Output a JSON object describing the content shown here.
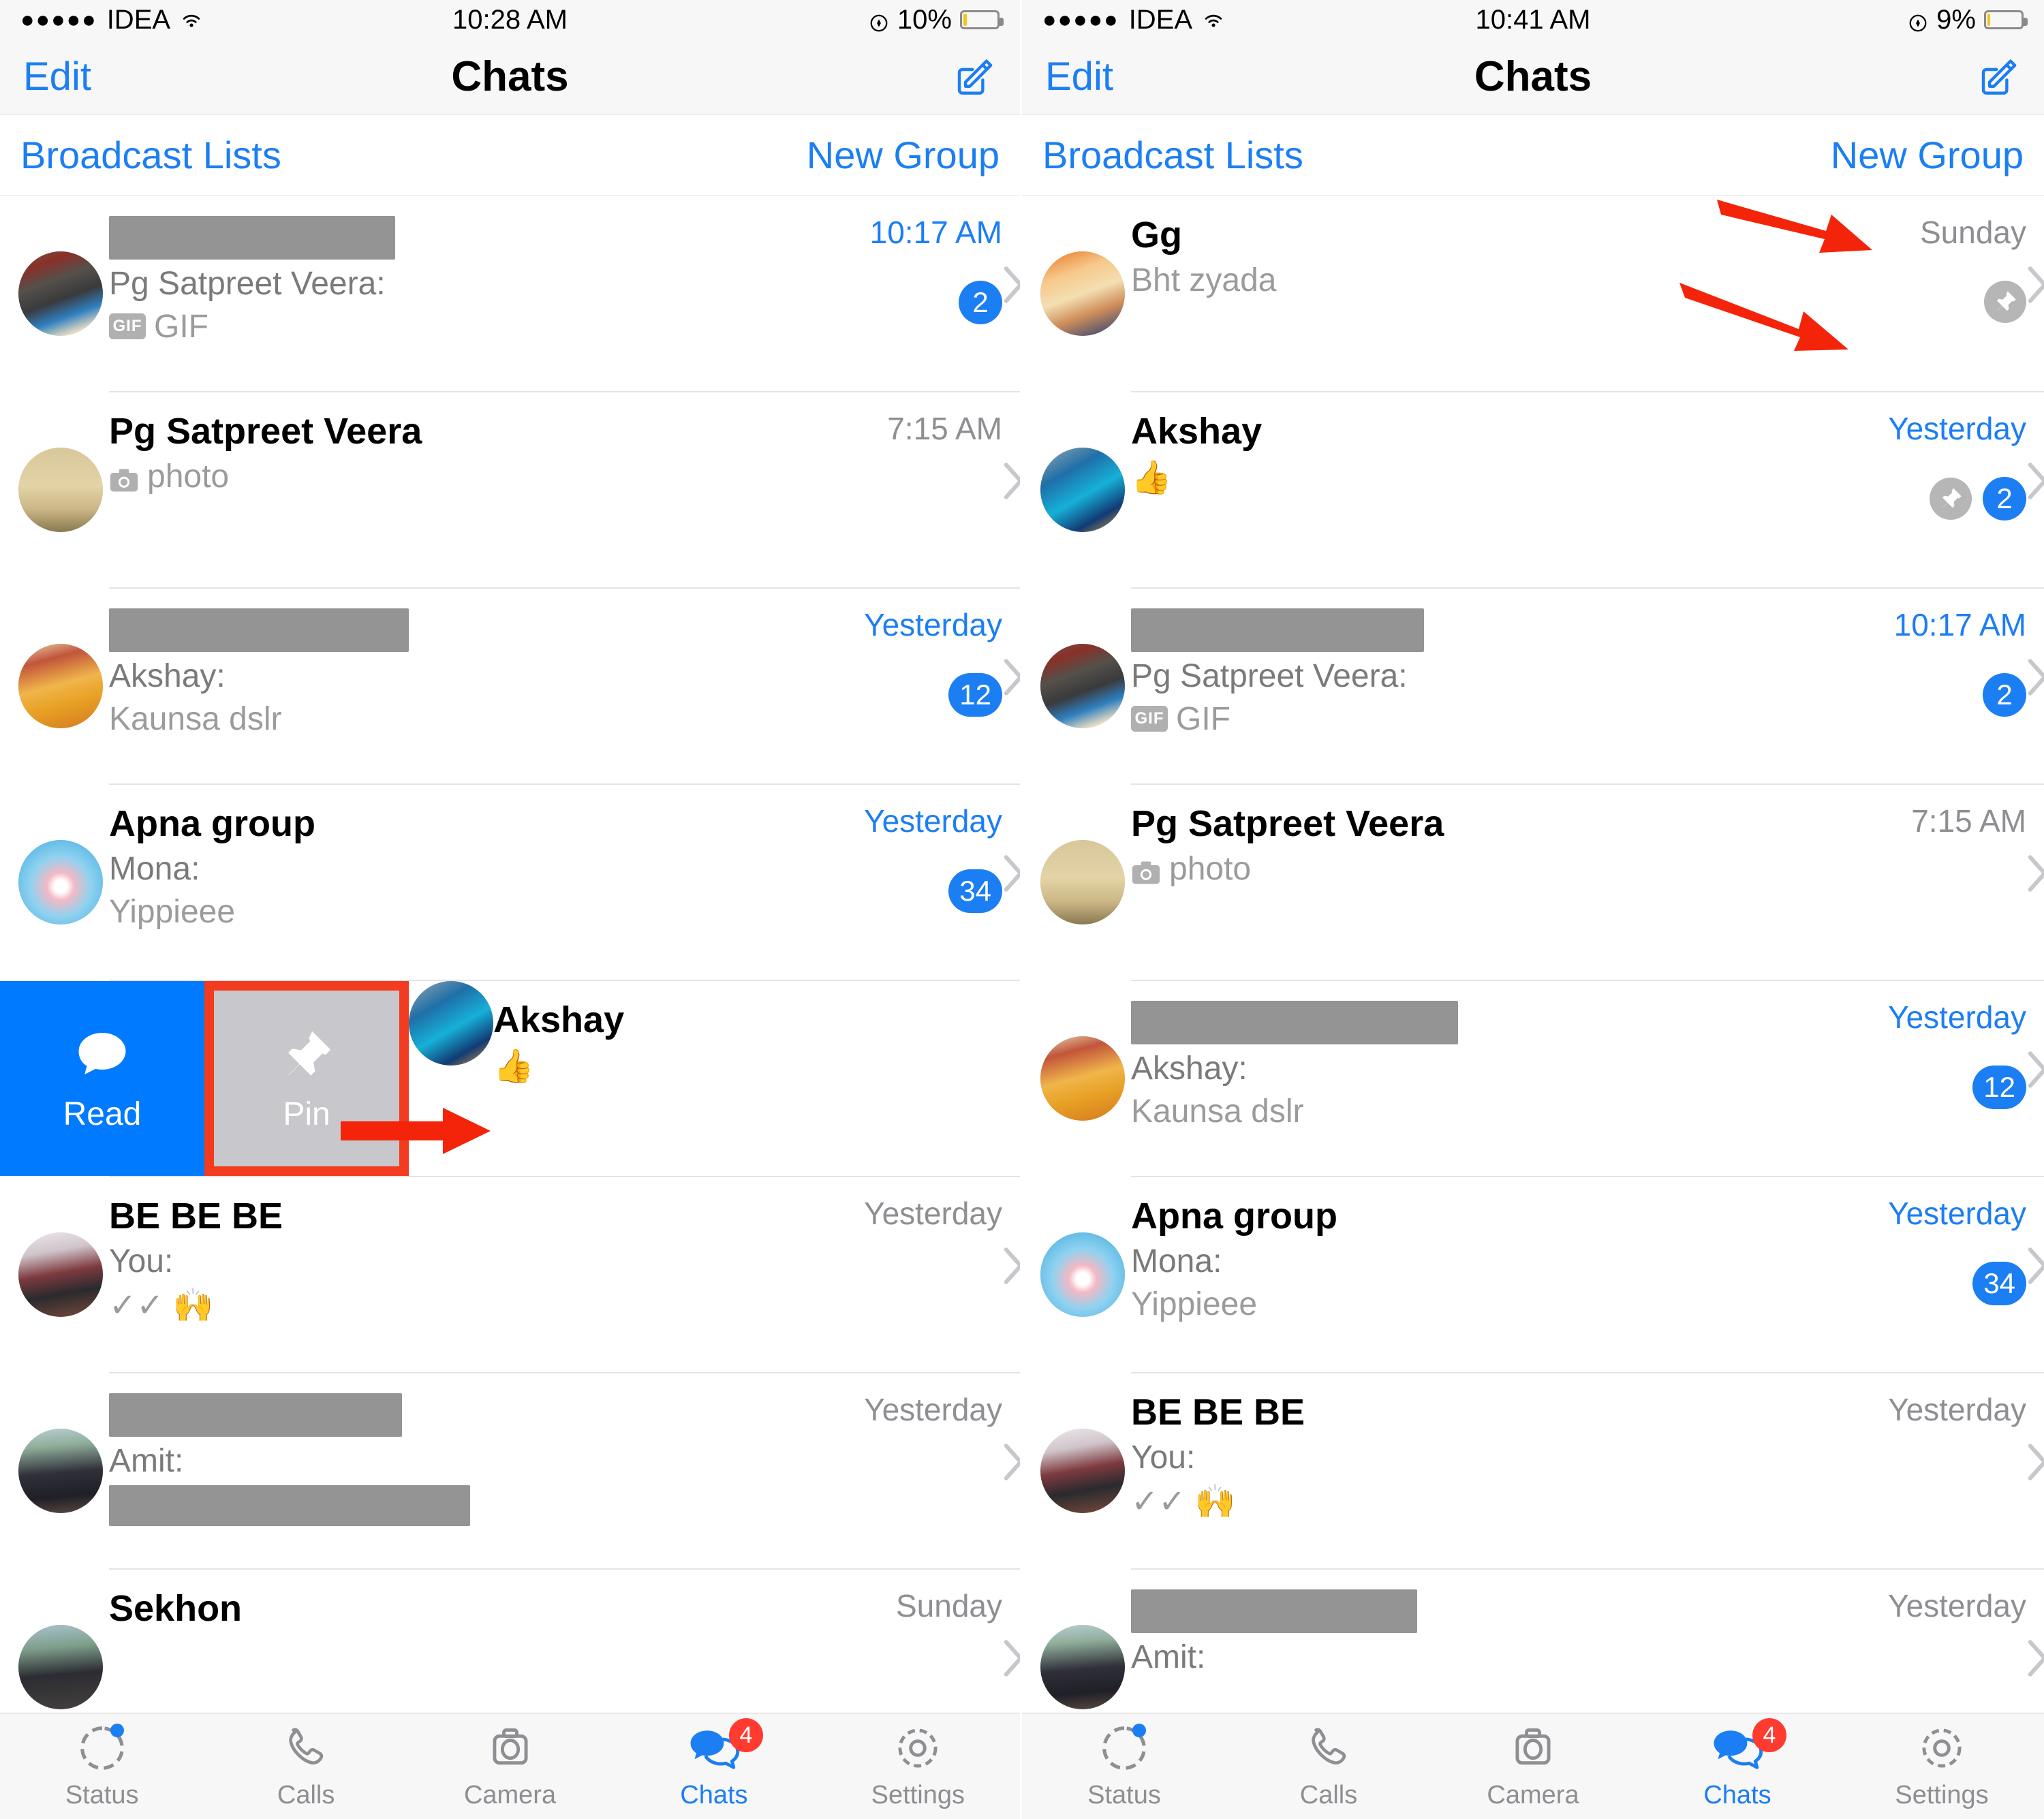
{
  "panels": [
    {
      "status": {
        "signal_dots": "●●●●●",
        "carrier": "IDEA",
        "time": "10:28 AM",
        "battery_pct": "10%",
        "battery_level": 10
      },
      "nav": {
        "edit": "Edit",
        "title": "Chats"
      },
      "header": {
        "broadcast": "Broadcast Lists",
        "new_group": "New Group"
      },
      "rows": [
        {
          "kind": "chat",
          "title": "",
          "title_redacted": true,
          "title_redact_w": 420,
          "sender": "Pg Satpreet Veera:",
          "preview": "GIF",
          "preview_icon": "gif-chip",
          "time": "10:17 AM",
          "time_blue": true,
          "badge": "2",
          "pinned": false,
          "avatar": "market-stall"
        },
        {
          "kind": "chat",
          "title": "Pg Satpreet Veera",
          "sender": "",
          "preview": "photo",
          "preview_icon": "camera-chip",
          "time": "7:15 AM",
          "time_blue": false,
          "badge": "",
          "pinned": false,
          "avatar": "boat-quote"
        },
        {
          "kind": "chat",
          "title": "",
          "title_redacted": true,
          "title_redact_w": 440,
          "sender": "Akshay:",
          "preview": "Kaunsa dslr",
          "preview_icon": "",
          "time": "Yesterday",
          "time_blue": true,
          "badge": "12",
          "pinned": false,
          "avatar": "festival"
        },
        {
          "kind": "chat",
          "title": "Apna group",
          "sender": "Mona:",
          "preview": "Yippieee",
          "preview_icon": "",
          "time": "Yesterday",
          "time_blue": true,
          "badge": "34",
          "pinned": false,
          "avatar": "heart"
        },
        {
          "kind": "swipe",
          "read_label": "Read",
          "pin_label": "Pin",
          "title": "Akshay",
          "preview": "👍",
          "avatar": "shiva"
        },
        {
          "kind": "chat",
          "title": "BE BE BE",
          "sender": "You:",
          "preview": "✓✓ 🙌",
          "preview_icon": "",
          "time": "Yesterday",
          "time_blue": false,
          "badge": "",
          "pinned": false,
          "avatar": "group-selfie"
        },
        {
          "kind": "chat",
          "title": "",
          "title_redacted": true,
          "title_redact_w": 430,
          "sender": "Amit:",
          "preview": "",
          "preview_redacted": true,
          "preview_redact_w": 530,
          "time": "Yesterday",
          "time_blue": false,
          "badge": "",
          "pinned": false,
          "avatar": "friends"
        },
        {
          "kind": "chat",
          "title": "Sekhon",
          "sender": "",
          "preview": "",
          "preview_icon": "",
          "time": "Sunday",
          "time_blue": false,
          "badge": "",
          "pinned": false,
          "avatar": "outdoor"
        }
      ],
      "tabs": [
        {
          "label": "Status",
          "icon": "status-icon",
          "active": false,
          "badge": "",
          "dot": true
        },
        {
          "label": "Calls",
          "icon": "phone-icon",
          "active": false,
          "badge": "",
          "dot": false
        },
        {
          "label": "Camera",
          "icon": "camera-icon",
          "active": false,
          "badge": "",
          "dot": false
        },
        {
          "label": "Chats",
          "icon": "chats-icon",
          "active": true,
          "badge": "4",
          "dot": false
        },
        {
          "label": "Settings",
          "icon": "gear-icon",
          "active": false,
          "badge": "",
          "dot": false
        }
      ]
    },
    {
      "status": {
        "signal_dots": "●●●●●",
        "carrier": "IDEA",
        "time": "10:41 AM",
        "battery_pct": "9%",
        "battery_level": 9
      },
      "nav": {
        "edit": "Edit",
        "title": "Chats"
      },
      "header": {
        "broadcast": "Broadcast Lists",
        "new_group": "New Group"
      },
      "rows": [
        {
          "kind": "chat",
          "title": "Gg",
          "sender": "",
          "preview": "Bht zyada",
          "preview_icon": "",
          "time": "Sunday",
          "time_blue": false,
          "badge": "",
          "pinned": true,
          "avatar": "couple",
          "arrow": true
        },
        {
          "kind": "chat",
          "title": "Akshay",
          "sender": "",
          "preview": "👍",
          "preview_icon": "",
          "time": "Yesterday",
          "time_blue": true,
          "badge": "2",
          "pinned": true,
          "avatar": "shiva",
          "arrow": true
        },
        {
          "kind": "chat",
          "title": "",
          "title_redacted": true,
          "title_redact_w": 430,
          "sender": "Pg Satpreet Veera:",
          "preview": "GIF",
          "preview_icon": "gif-chip",
          "time": "10:17 AM",
          "time_blue": true,
          "badge": "2",
          "pinned": false,
          "avatar": "market-stall"
        },
        {
          "kind": "chat",
          "title": "Pg Satpreet Veera",
          "sender": "",
          "preview": "photo",
          "preview_icon": "camera-chip",
          "time": "7:15 AM",
          "time_blue": false,
          "badge": "",
          "pinned": false,
          "avatar": "boat-quote"
        },
        {
          "kind": "chat",
          "title": "",
          "title_redacted": true,
          "title_redact_w": 480,
          "sender": "Akshay:",
          "preview": "Kaunsa dslr",
          "preview_icon": "",
          "time": "Yesterday",
          "time_blue": true,
          "badge": "12",
          "pinned": false,
          "avatar": "festival"
        },
        {
          "kind": "chat",
          "title": "Apna group",
          "sender": "Mona:",
          "preview": "Yippieee",
          "preview_icon": "",
          "time": "Yesterday",
          "time_blue": true,
          "badge": "34",
          "pinned": false,
          "avatar": "heart"
        },
        {
          "kind": "chat",
          "title": "BE BE BE",
          "sender": "You:",
          "preview": "✓✓ 🙌",
          "preview_icon": "",
          "time": "Yesterday",
          "time_blue": false,
          "badge": "",
          "pinned": false,
          "avatar": "group-selfie"
        },
        {
          "kind": "chat",
          "title": "",
          "title_redacted": true,
          "title_redact_w": 420,
          "sender": "Amit:",
          "preview": "",
          "preview_icon": "",
          "time": "Yesterday",
          "time_blue": false,
          "badge": "",
          "pinned": false,
          "avatar": "friends"
        }
      ],
      "tabs": [
        {
          "label": "Status",
          "icon": "status-icon",
          "active": false,
          "badge": "",
          "dot": true
        },
        {
          "label": "Calls",
          "icon": "phone-icon",
          "active": false,
          "badge": "",
          "dot": false
        },
        {
          "label": "Camera",
          "icon": "camera-icon",
          "active": false,
          "badge": "",
          "dot": false
        },
        {
          "label": "Chats",
          "icon": "chats-icon",
          "active": true,
          "badge": "4",
          "dot": false
        },
        {
          "label": "Settings",
          "icon": "gear-icon",
          "active": false,
          "badge": "",
          "dot": false
        }
      ]
    }
  ],
  "colors": {
    "accent": "#1c7ef3",
    "badge": "#1c7ef3",
    "tab_badge": "#ff3b30",
    "annotation_arrow": "#f4240a",
    "highlight_box": "#f33b20",
    "read_action": "#007aff",
    "pin_action": "#c7c7cc",
    "redact": "#949494"
  }
}
